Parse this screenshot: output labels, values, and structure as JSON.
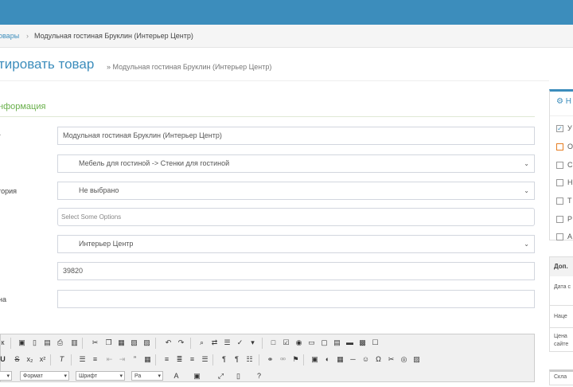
{
  "breadcrumb": {
    "link": "овары",
    "separator": "›",
    "current": "Модульная гостиная Бруклин (Интерьер Центр)"
  },
  "page": {
    "title": "тировать товар",
    "subtitle": "» Модульная гостиная Бруклин (Интерьер Центр)"
  },
  "section": {
    "title": "нформация"
  },
  "labels": {
    "category": "гория",
    "price_label": "на",
    "short": "-"
  },
  "fields": {
    "name": "Модульная гостиная Бруклин (Интерьер Центр)",
    "category": "Мебель для гостиной -> Стенки для гостиной",
    "subcategory": "Не выбрано",
    "options_placeholder": "Select Some Options",
    "manufacturer": "Интерьер Центр",
    "price": "39820",
    "extra": ""
  },
  "toolbar": {
    "row3": {
      "format": "Формат",
      "font": "Шрифт",
      "size": "Ра"
    }
  },
  "right_panel": {
    "header": "Н",
    "options": [
      {
        "label": "У",
        "checked": true
      },
      {
        "label": "О",
        "checked": false
      },
      {
        "label": "С",
        "checked": false
      },
      {
        "label": "Н",
        "checked": false
      },
      {
        "label": "Т",
        "checked": false
      },
      {
        "label": "Р",
        "checked": false
      },
      {
        "label": "А",
        "checked": false
      }
    ]
  },
  "right_table": {
    "header": "Доп.",
    "row1": "Дата с",
    "row2": "Наце",
    "row3a": "Цена",
    "row3b": "сайте"
  },
  "right_box2": {
    "header": "Скла"
  },
  "colors": {
    "brand": "#3c8dbc",
    "section": "#6ab04c",
    "orange": "#e67e22"
  }
}
